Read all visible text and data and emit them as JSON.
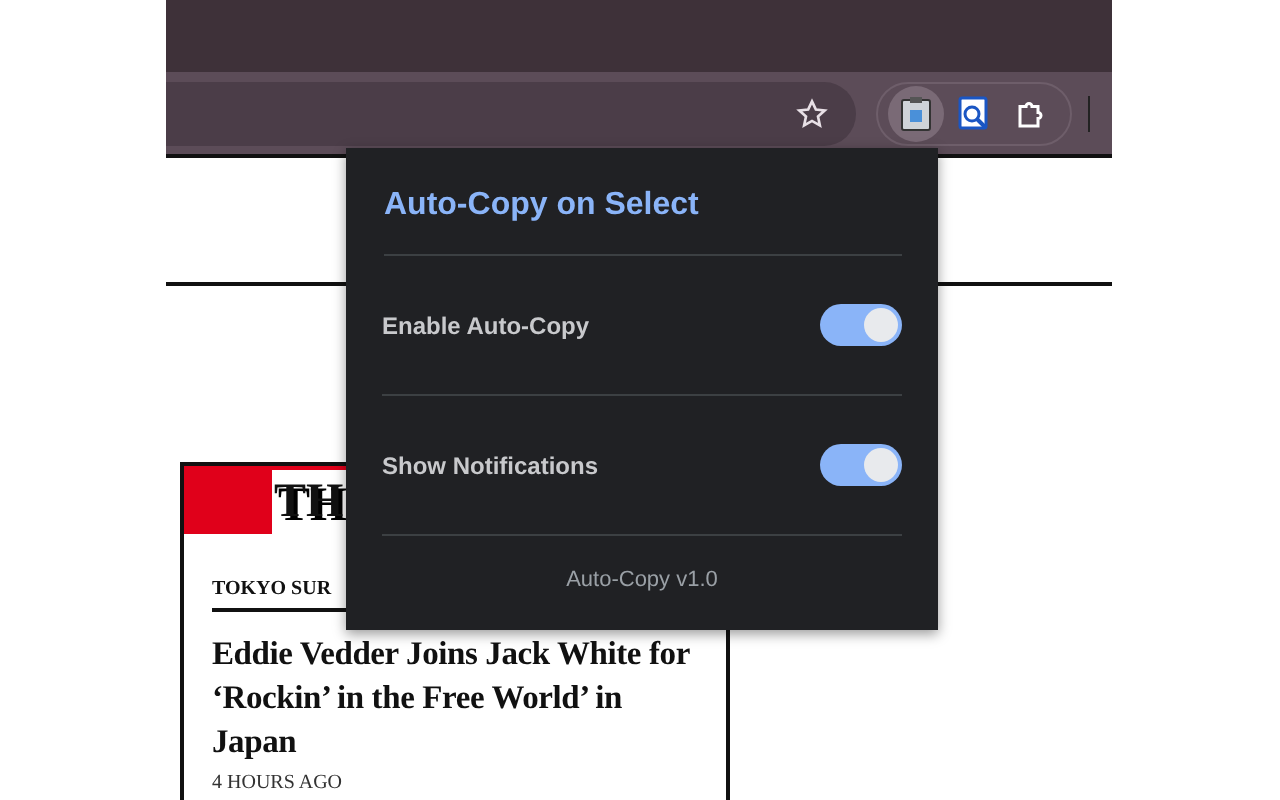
{
  "article": {
    "logo": "TH",
    "section": "TOKYO SUR",
    "headline": "Eddie Vedder Joins Jack White for ‘Rockin’ in the Free World’ in Japan",
    "time": "4 HOURS AGO"
  },
  "popup": {
    "title": "Auto-Copy on Select",
    "settings": [
      {
        "label": "Enable Auto-Copy",
        "on": true
      },
      {
        "label": "Show Notifications",
        "on": true
      }
    ],
    "footer": "Auto-Copy v1.0"
  }
}
